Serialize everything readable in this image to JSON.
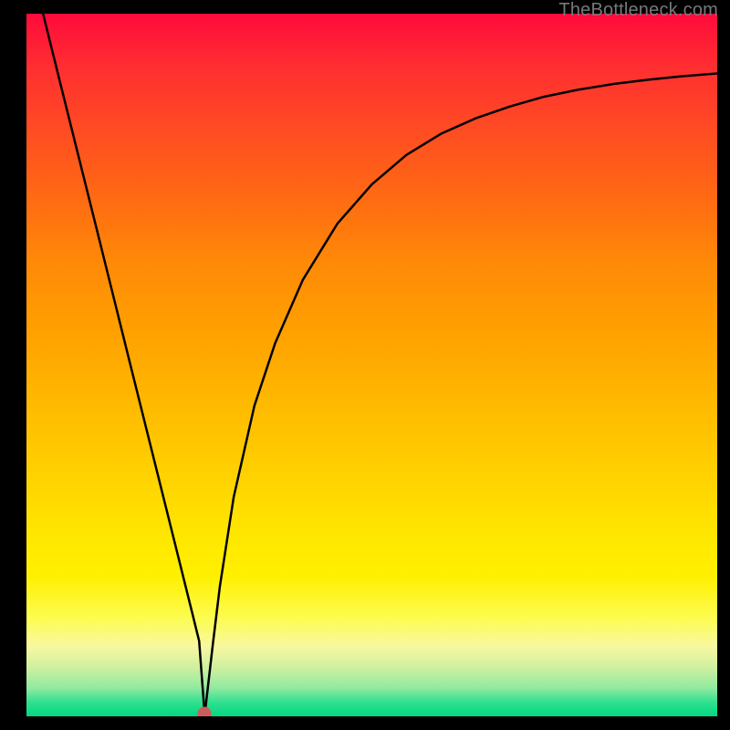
{
  "attribution": "TheBottleneck.com",
  "marker": {
    "color": "#cd5c5c",
    "x_fraction": 0.258,
    "y_fraction": 1.0
  },
  "chart_data": {
    "type": "line",
    "title": "",
    "xlabel": "",
    "ylabel": "",
    "xlim": [
      0,
      100
    ],
    "ylim": [
      0,
      100
    ],
    "series": [
      {
        "name": "bottleneck-curve",
        "x": [
          2.4,
          5,
          10,
          15,
          20,
          22,
          24,
          25,
          25.8,
          27,
          28,
          30,
          33,
          36,
          40,
          45,
          50,
          55,
          60,
          65,
          70,
          75,
          80,
          85,
          90,
          95,
          100
        ],
        "y": [
          100,
          89.7,
          70.0,
          50.2,
          30.5,
          22.6,
          14.7,
          10.7,
          0.2,
          10.4,
          18.5,
          31.2,
          44.2,
          53.1,
          62.1,
          70.1,
          75.7,
          79.9,
          82.9,
          85.1,
          86.8,
          88.2,
          89.2,
          90.0,
          90.6,
          91.1,
          91.5
        ]
      }
    ],
    "annotations": [
      {
        "type": "point",
        "x": 25.8,
        "y": 0,
        "color": "#cd5c5c"
      }
    ],
    "background": "vertical-gradient red-yellow-green",
    "grid": false
  }
}
